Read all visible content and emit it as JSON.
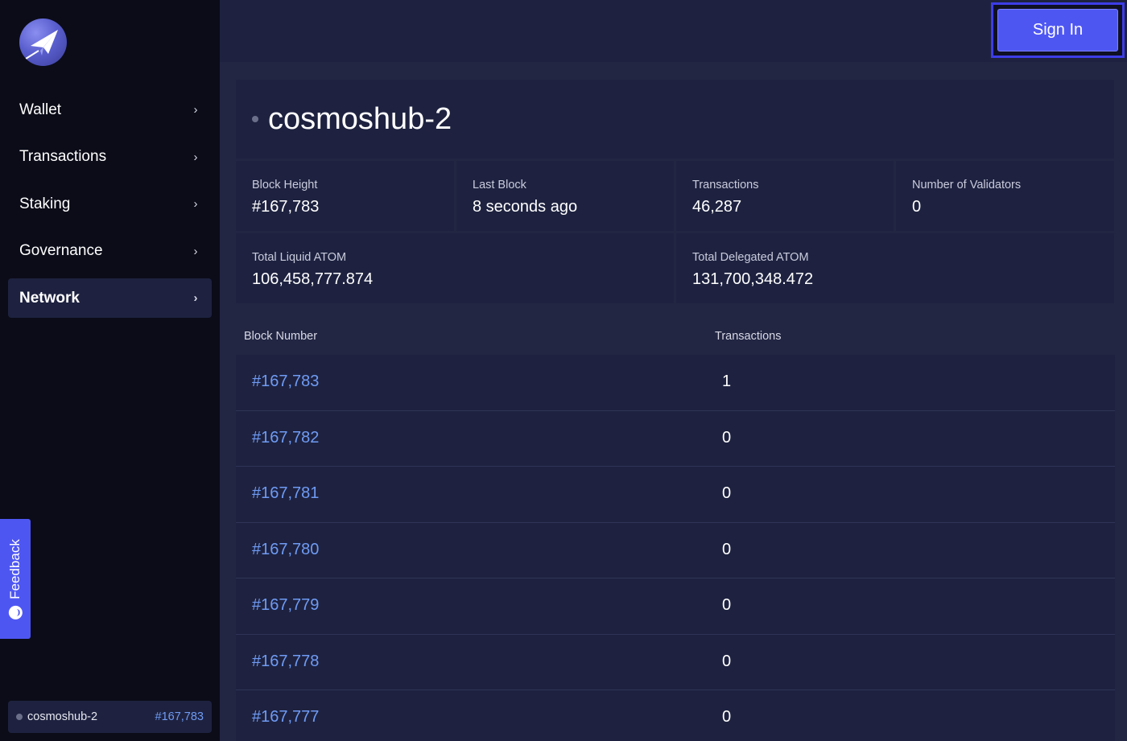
{
  "sidebar": {
    "nav": [
      {
        "label": "Wallet"
      },
      {
        "label": "Transactions"
      },
      {
        "label": "Staking"
      },
      {
        "label": "Governance"
      },
      {
        "label": "Network"
      }
    ],
    "chevron": "›",
    "feedback_label": "Feedback",
    "footer": {
      "network": "cosmoshub-2",
      "block": "#167,783"
    }
  },
  "header": {
    "signin_label": "Sign In"
  },
  "network": {
    "title": "cosmoshub-2",
    "stats": [
      {
        "label": "Block Height",
        "value": "#167,783"
      },
      {
        "label": "Last Block",
        "value": "8 seconds ago"
      },
      {
        "label": "Transactions",
        "value": "46,287"
      },
      {
        "label": "Number of Validators",
        "value": "0"
      },
      {
        "label": "Total Liquid ATOM",
        "value": "106,458,777.874"
      },
      {
        "label": "Total Delegated ATOM",
        "value": "131,700,348.472"
      }
    ]
  },
  "blocks": {
    "headers": [
      "Block Number",
      "Transactions"
    ],
    "rows": [
      {
        "block": "#167,783",
        "tx": "1"
      },
      {
        "block": "#167,782",
        "tx": "0"
      },
      {
        "block": "#167,781",
        "tx": "0"
      },
      {
        "block": "#167,780",
        "tx": "0"
      },
      {
        "block": "#167,779",
        "tx": "0"
      },
      {
        "block": "#167,778",
        "tx": "0"
      },
      {
        "block": "#167,777",
        "tx": "0"
      }
    ]
  },
  "colors": {
    "accent": "#4e56f2",
    "link": "#6f9bf4",
    "sidebar": "#0b0c18",
    "panel": "#1e2240"
  }
}
